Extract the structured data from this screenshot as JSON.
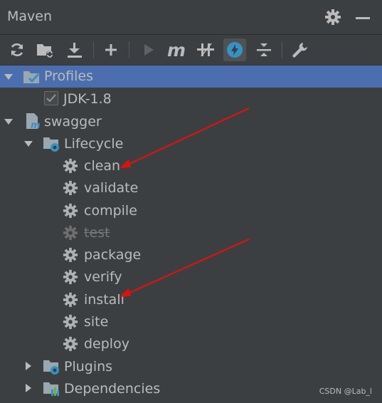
{
  "window": {
    "title": "Maven"
  },
  "toolbar": {
    "buttons": [
      {
        "icon": "reload-icon"
      },
      {
        "icon": "folder-sync-icon"
      },
      {
        "icon": "download-icon"
      },
      {
        "icon": "plus-icon"
      },
      {
        "icon": "run-icon"
      },
      {
        "icon": "maven-m-icon"
      },
      {
        "icon": "skip-tests-icon"
      },
      {
        "icon": "offline-lightning-icon"
      },
      {
        "icon": "collapse-icon"
      },
      {
        "icon": "wrench-icon"
      }
    ]
  },
  "tree": {
    "profiles": {
      "label": "Profiles",
      "items": [
        {
          "label": "JDK-1.8",
          "checked": true
        }
      ]
    },
    "project": {
      "label": "swagger",
      "lifecycle": {
        "label": "Lifecycle",
        "phases": [
          {
            "label": "clean"
          },
          {
            "label": "validate"
          },
          {
            "label": "compile"
          },
          {
            "label": "test",
            "disabled": true
          },
          {
            "label": "package"
          },
          {
            "label": "verify"
          },
          {
            "label": "install"
          },
          {
            "label": "site"
          },
          {
            "label": "deploy"
          }
        ]
      },
      "plugins": {
        "label": "Plugins"
      },
      "dependencies": {
        "label": "Dependencies"
      }
    }
  },
  "watermark": "CSDN @Lab_l",
  "colors": {
    "background": "#3c3f41",
    "selection": "#4b6eaf",
    "annotation_arrow": "#e01010",
    "icon": "#bbbbbb",
    "accent": "#3592c4"
  }
}
